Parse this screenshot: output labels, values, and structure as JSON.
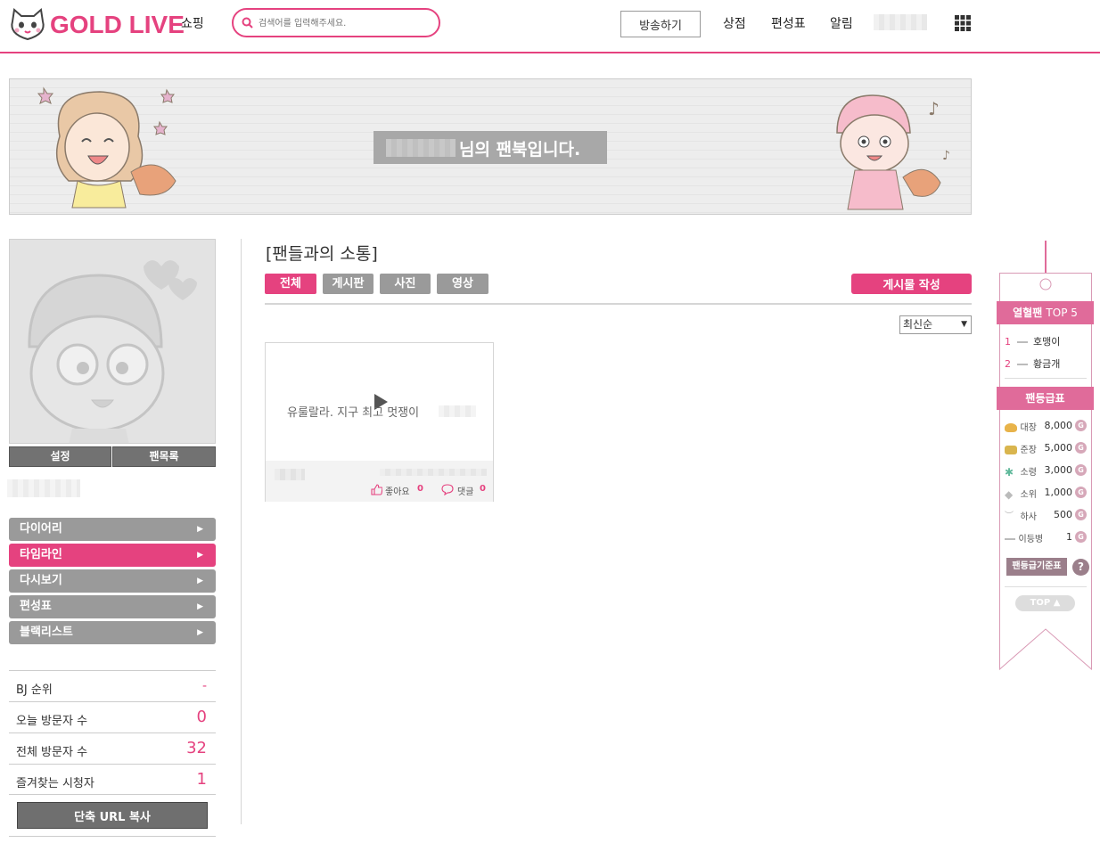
{
  "header": {
    "logo": "GOLD LIVE",
    "nav_shopping": "쇼핑",
    "search_placeholder": "검색어를 입력해주세요.",
    "broadcast_button": "방송하기",
    "nav_store": "상점",
    "nav_schedule": "편성표",
    "nav_alerts": "알림"
  },
  "banner": {
    "title_suffix": "님의 팬북입니다."
  },
  "profile": {
    "settings_button": "설정",
    "fan_list_button": "팬목록"
  },
  "menu": [
    {
      "label": "다이어리"
    },
    {
      "label": "타임라인"
    },
    {
      "label": "다시보기"
    },
    {
      "label": "편성표"
    },
    {
      "label": "블랙리스트"
    }
  ],
  "stats": [
    {
      "label": "BJ 순위",
      "value": "-"
    },
    {
      "label": "오늘 방문자 수",
      "value": "0"
    },
    {
      "label": "전체 방문자 수",
      "value": "32"
    },
    {
      "label": "즐겨찾는 시청자",
      "value": "1"
    }
  ],
  "url_copy_button": "단축 URL 복사",
  "main": {
    "section_title": "[팬들과의 소통]",
    "tabs": [
      "전체",
      "게시판",
      "사진",
      "영상"
    ],
    "write_button": "게시물 작성",
    "sort_selected": "최신순",
    "post": {
      "text": "유룰랄라. 지구 최고 멋쟁이",
      "likes_label": "좋아요",
      "likes": "0",
      "comments_label": "댓글",
      "comments": "0"
    }
  },
  "sidebar": {
    "top5_title_a": "열혈팬",
    "top5_title_b": "TOP 5",
    "top5": [
      {
        "rank": "1",
        "name": "호맹이"
      },
      {
        "rank": "2",
        "name": "황금개"
      }
    ],
    "grade_title": "팬등급표",
    "grades": [
      {
        "name": "대장",
        "value": "8,000"
      },
      {
        "name": "준장",
        "value": "5,000"
      },
      {
        "name": "소령",
        "value": "3,000"
      },
      {
        "name": "소위",
        "value": "1,000"
      },
      {
        "name": "하사",
        "value": "500"
      },
      {
        "name": "이등병",
        "value": "1"
      }
    ],
    "coin_letter": "G",
    "grade_criteria_button": "팬등급기준표",
    "help_glyph": "?",
    "top_button": "TOP ▲"
  },
  "colors": {
    "accent": "#e5427f",
    "menu_gray": "#9a9a9a"
  }
}
